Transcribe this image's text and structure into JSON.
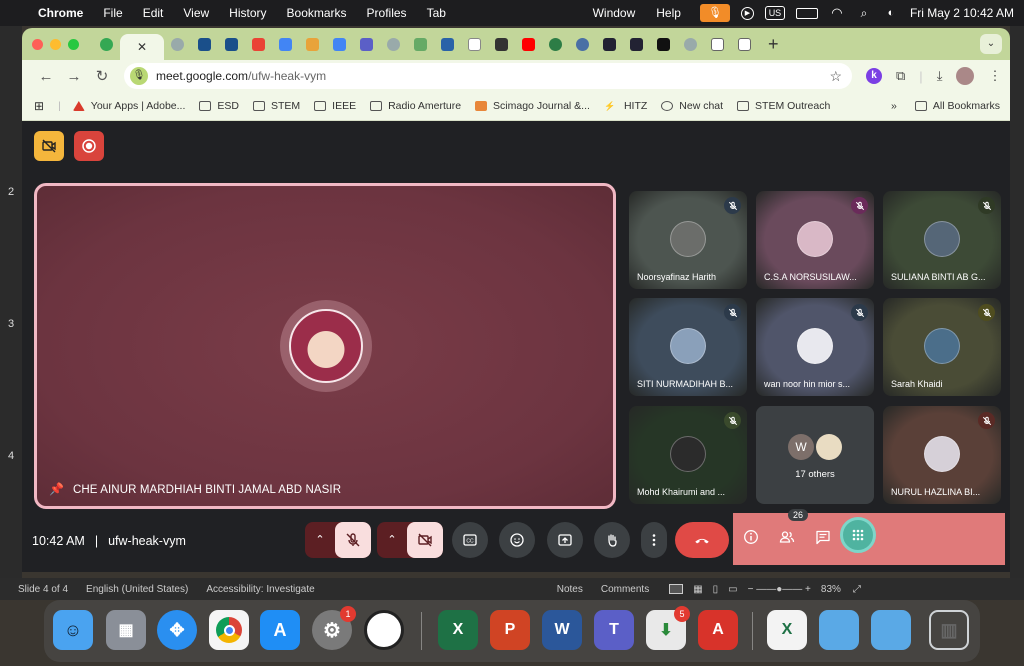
{
  "menubar": {
    "app": "Chrome",
    "items": [
      "File",
      "Edit",
      "View",
      "History",
      "Bookmarks",
      "Profiles",
      "Tab",
      "Window",
      "Help"
    ],
    "input_source": "US",
    "clock": "Fri May 2  10:42 AM"
  },
  "browser": {
    "url_host": "meet.google.com",
    "url_path": "/ufw-heak-vym",
    "bookmarks": [
      {
        "label": "Your Apps | Adobe...",
        "icon": "adobe"
      },
      {
        "label": "ESD",
        "icon": "folder"
      },
      {
        "label": "STEM",
        "icon": "folder"
      },
      {
        "label": "IEEE",
        "icon": "folder"
      },
      {
        "label": "Radio Amerture",
        "icon": "folder"
      },
      {
        "label": "Scimago Journal &...",
        "icon": "sjr"
      },
      {
        "label": "HITZ",
        "icon": "hitz"
      },
      {
        "label": "New chat",
        "icon": "chat"
      },
      {
        "label": "STEM Outreach",
        "icon": "folder"
      }
    ],
    "all_bookmarks": "All Bookmarks"
  },
  "meet": {
    "main_speaker": "CHE AINUR MARDHIAH BINTI JAMAL ABD NASIR",
    "participants": [
      {
        "name": "Noorsyafinaz Harith",
        "bg": "#4d5550"
      },
      {
        "name": "C.S.A NORSUSILAW...",
        "bg": "#6a4a5c"
      },
      {
        "name": "SULIANA BINTI AB G...",
        "bg": "#3d4a36"
      },
      {
        "name": "SITI NURMADIHAH B...",
        "bg": "#3e4c5c"
      },
      {
        "name": "wan noor hin mior s...",
        "bg": "#50556a"
      },
      {
        "name": "Sarah Khaidi",
        "bg": "#4a4c36"
      },
      {
        "name": "Mohd Khairumi and ...",
        "bg": "#263626"
      },
      {
        "name": "NURUL HAZLINA BI...",
        "bg": "#5a4038"
      }
    ],
    "others_initial": "W",
    "others_label": "17 others",
    "time": "10:42 AM",
    "separator": "|",
    "meeting_code": "ufw-heak-vym",
    "people_count": "26"
  },
  "ppt": {
    "slide_numbers": [
      "2",
      "3",
      "4"
    ],
    "slide_info": "Slide 4 of 4",
    "language": "English (United States)",
    "accessibility": "Accessibility: Investigate",
    "notes": "Notes",
    "comments": "Comments",
    "zoom": "83%"
  },
  "dock": {
    "apps": [
      {
        "name": "Finder",
        "color": "#4aa3f0"
      },
      {
        "name": "Launchpad",
        "color": "#8a8f98"
      },
      {
        "name": "Safari",
        "color": "#2a8ff0"
      },
      {
        "name": "Chrome",
        "color": "#f5f5f5"
      },
      {
        "name": "App Store",
        "color": "#1f8ef5"
      },
      {
        "name": "System Settings",
        "color": "#7a7a7a"
      },
      {
        "name": "Clock",
        "color": "#ffffff"
      },
      {
        "name": "Excel",
        "color": "#1e7145"
      },
      {
        "name": "PowerPoint",
        "color": "#d04424"
      },
      {
        "name": "Word",
        "color": "#2b579a"
      },
      {
        "name": "Teams",
        "color": "#5b5fc7"
      },
      {
        "name": "Installer",
        "color": "#e9e9e9"
      },
      {
        "name": "Acrobat",
        "color": "#d8332a"
      },
      {
        "name": "Excel Doc",
        "color": "#f3f3f3"
      },
      {
        "name": "Folder",
        "color": "#5aa9e6"
      },
      {
        "name": "Folder 2",
        "color": "#5aa9e6"
      },
      {
        "name": "Trash",
        "color": "#cfd3d6"
      }
    ],
    "settings_badge": "1",
    "installer_badge": "5"
  }
}
